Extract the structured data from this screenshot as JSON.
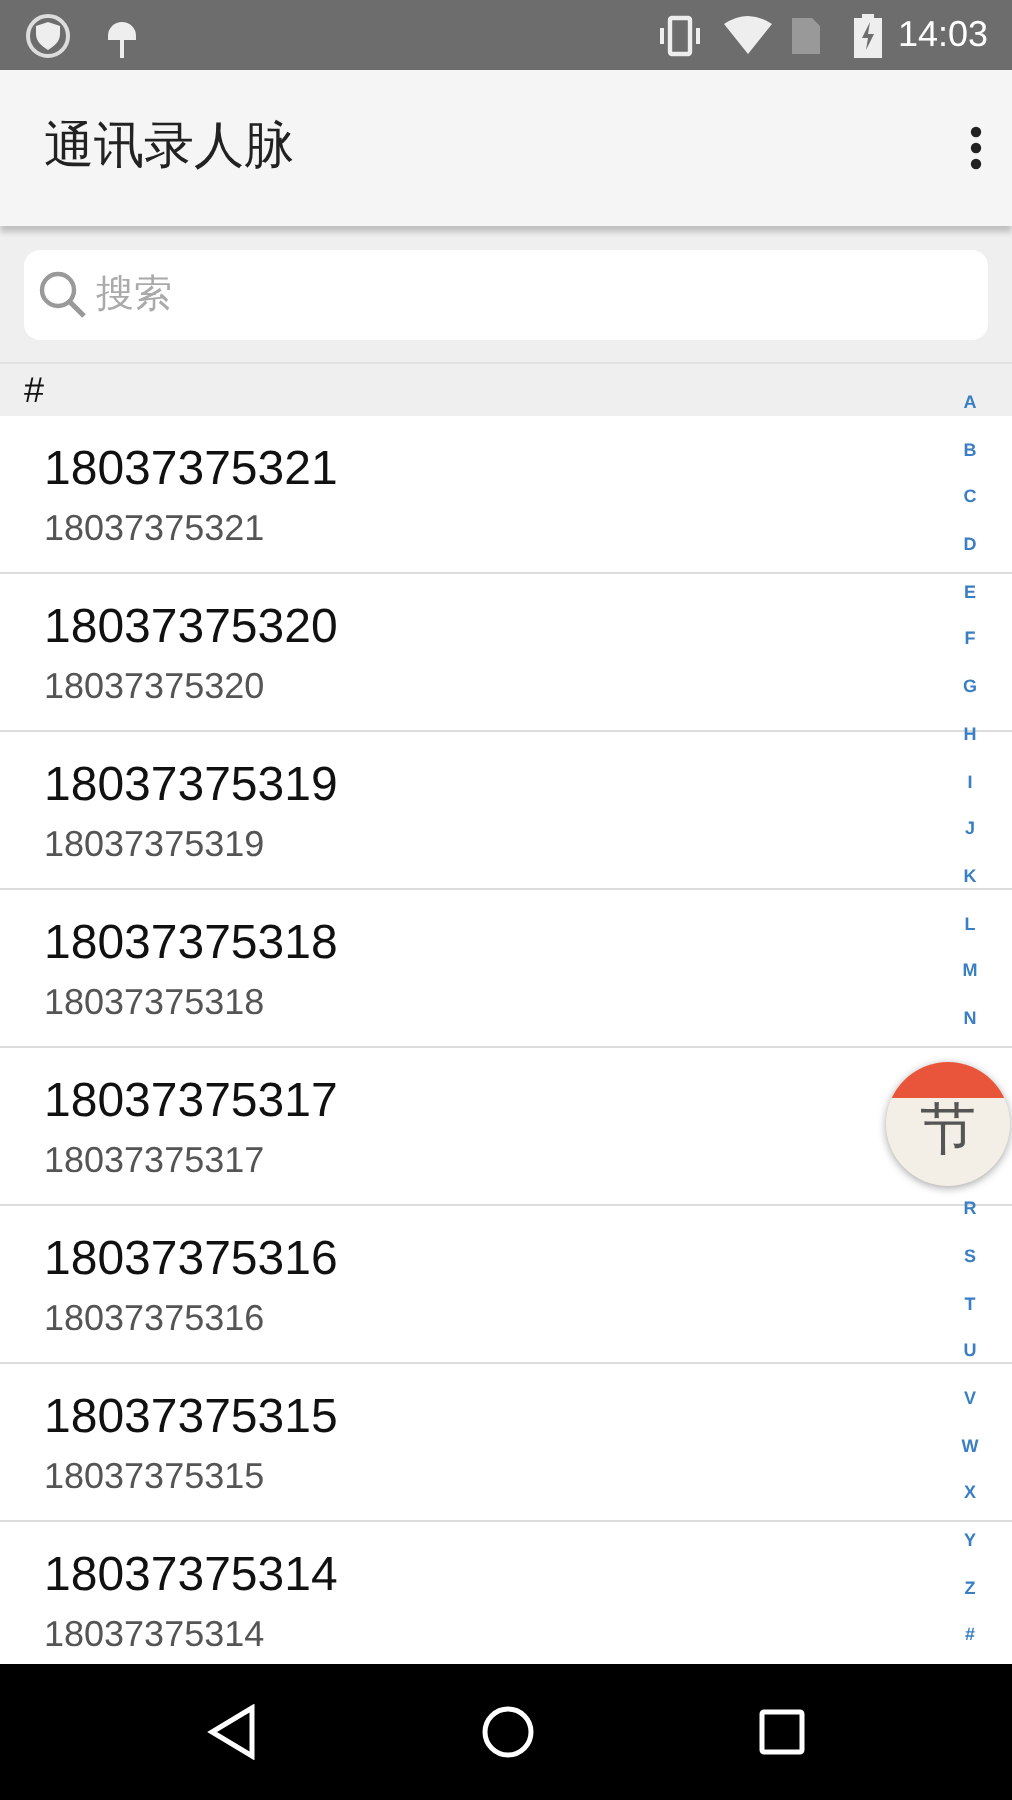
{
  "status_bar": {
    "time": "14:03"
  },
  "app_bar": {
    "title": "通讯录人脉"
  },
  "search": {
    "placeholder": "搜索"
  },
  "section": {
    "header": "#"
  },
  "contacts": [
    {
      "name": "18037375321",
      "number": "18037375321"
    },
    {
      "name": "18037375320",
      "number": "18037375320"
    },
    {
      "name": "18037375319",
      "number": "18037375319"
    },
    {
      "name": "18037375318",
      "number": "18037375318"
    },
    {
      "name": "18037375317",
      "number": "18037375317"
    },
    {
      "name": "18037375316",
      "number": "18037375316"
    },
    {
      "name": "18037375315",
      "number": "18037375315"
    },
    {
      "name": "18037375314",
      "number": "18037375314"
    }
  ],
  "index_top": [
    "A",
    "B",
    "C",
    "D",
    "E",
    "F",
    "G",
    "H",
    "I",
    "J",
    "K",
    "L",
    "M",
    "N"
  ],
  "index_bottom": [
    "R",
    "S",
    "T",
    "U",
    "V",
    "W",
    "X",
    "Y",
    "Z",
    "#"
  ],
  "floating_button": {
    "label": "节"
  }
}
